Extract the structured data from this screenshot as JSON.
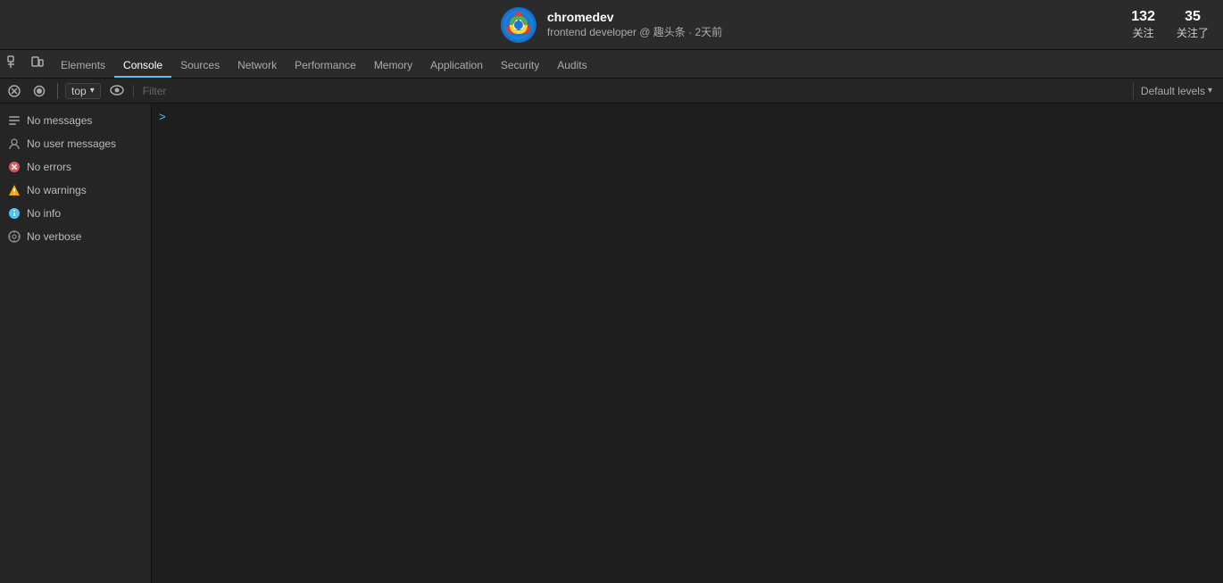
{
  "topbar": {
    "logo": "chrome-icon",
    "username": "chromedev",
    "subtitle": "frontend developer @ 趣头条 · 2天前",
    "stat1_label": "关注",
    "stat1_value": "132",
    "stat2_label": "关注了",
    "stat2_value": "35"
  },
  "devtools": {
    "tabs": [
      {
        "id": "elements",
        "label": "Elements"
      },
      {
        "id": "console",
        "label": "Console"
      },
      {
        "id": "sources",
        "label": "Sources"
      },
      {
        "id": "network",
        "label": "Network"
      },
      {
        "id": "performance",
        "label": "Performance"
      },
      {
        "id": "memory",
        "label": "Memory"
      },
      {
        "id": "application",
        "label": "Application"
      },
      {
        "id": "security",
        "label": "Security"
      },
      {
        "id": "audits",
        "label": "Audits"
      }
    ],
    "active_tab": "console"
  },
  "toolbar": {
    "context_value": "top",
    "context_dropdown_arrow": "▾",
    "filter_placeholder": "Filter",
    "levels_label": "Default levels",
    "levels_arrow": "▾"
  },
  "sidebar": {
    "items": [
      {
        "id": "messages",
        "label": "No messages",
        "icon": "list-icon",
        "icon_char": "☰",
        "icon_class": "icon-messages"
      },
      {
        "id": "user-messages",
        "label": "No user messages",
        "icon": "user-icon",
        "icon_char": "👤",
        "icon_class": "icon-user"
      },
      {
        "id": "errors",
        "label": "No errors",
        "icon": "error-icon",
        "icon_char": "✖",
        "icon_class": "icon-error"
      },
      {
        "id": "warnings",
        "label": "No warnings",
        "icon": "warning-icon",
        "icon_char": "⚠",
        "icon_class": "icon-warning"
      },
      {
        "id": "info",
        "label": "No info",
        "icon": "info-icon",
        "icon_char": "ℹ",
        "icon_class": "icon-info"
      },
      {
        "id": "verbose",
        "label": "No verbose",
        "icon": "verbose-icon",
        "icon_char": "⚙",
        "icon_class": "icon-verbose"
      }
    ]
  },
  "console_area": {
    "prompt_arrow": ">"
  }
}
